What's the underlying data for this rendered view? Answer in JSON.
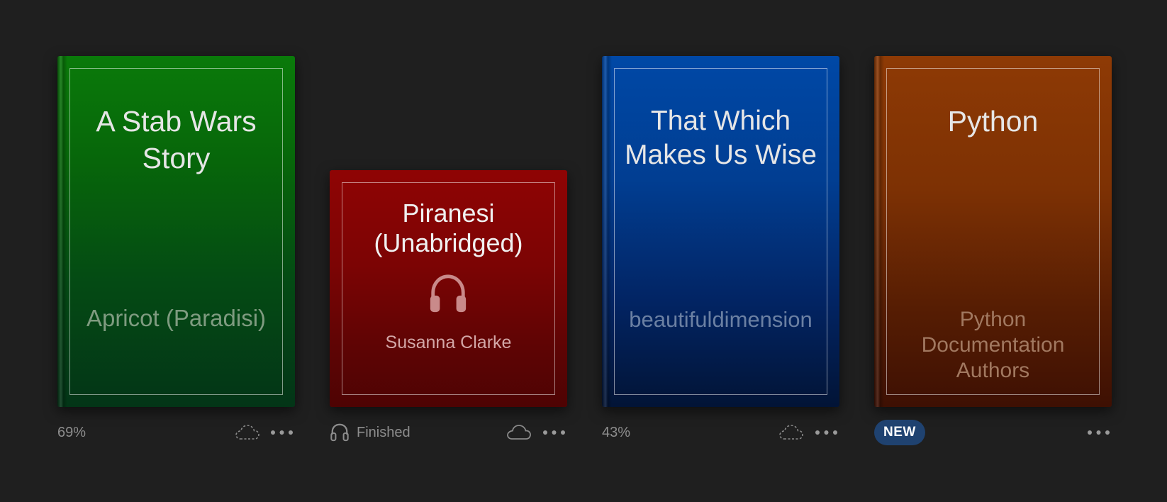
{
  "books": [
    {
      "title": "A Stab Wars Story",
      "author": "Apricot (Paradisi)",
      "progress": "69%",
      "cloud": "cloud-dashed-icon",
      "more": "more-icon"
    },
    {
      "title": "Piranesi (Unabridged)",
      "author": "Susanna Clarke",
      "kind_icon": "headphones-icon",
      "status": "Finished",
      "cloud": "cloud-icon",
      "more": "more-icon"
    },
    {
      "title": "That Which Makes Us Wise",
      "author": "beautifuldimension",
      "progress": "43%",
      "cloud": "cloud-dashed-icon",
      "more": "more-icon"
    },
    {
      "title": "Python",
      "author": "Python Documentation Authors",
      "badge": "NEW",
      "more": "more-icon"
    }
  ],
  "colors": {
    "background": "#1f1f1f",
    "green": "#0a7a0a",
    "red": "#8f0404",
    "blue": "#0048a6",
    "orange": "#8e3a05",
    "badge": "#1f4270"
  }
}
